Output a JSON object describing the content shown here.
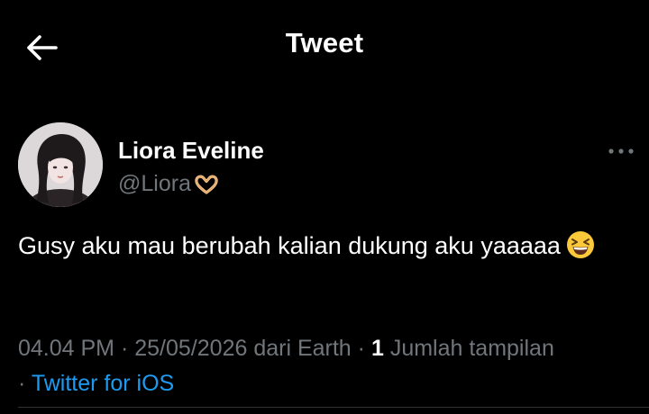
{
  "header": {
    "title": "Tweet",
    "back_icon": "arrow-left-icon"
  },
  "author": {
    "display_name": "Liora Eveline",
    "handle": "@Liora",
    "handle_emoji": "heart-hands-emoji",
    "more_icon": "more-horizontal-icon"
  },
  "tweet": {
    "text": "Gusy aku mau berubah kalian dukung aku yaaaaa",
    "emoji": "grinning-squinting-face-emoji"
  },
  "meta": {
    "time": "04.04 PM",
    "date": "25/05/2026",
    "location": "dari Earth",
    "views_count": "1",
    "views_label": "Jumlah tampilan",
    "source": "Twitter for iOS",
    "separator": "·"
  },
  "colors": {
    "background": "#000000",
    "text_primary": "#ffffff",
    "text_secondary": "#71767b",
    "link": "#1d9bf0",
    "divider": "#2f3336"
  }
}
